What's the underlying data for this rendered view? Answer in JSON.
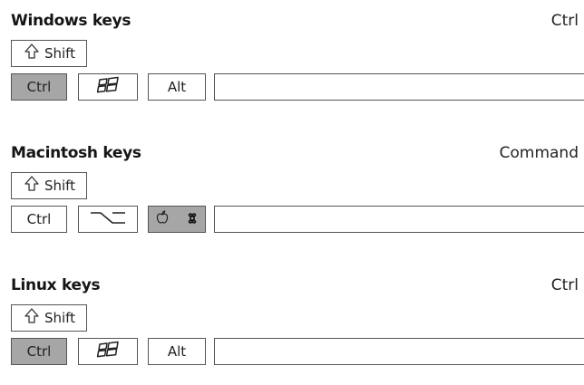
{
  "sections": [
    {
      "heading": "Windows keys",
      "modifier": "Ctrl",
      "shift_label": "Shift",
      "keys": [
        "Ctrl",
        "",
        "Alt"
      ]
    },
    {
      "heading": "Macintosh keys",
      "modifier": "Command",
      "shift_label": "Shift",
      "keys": [
        "Ctrl",
        "",
        ""
      ]
    },
    {
      "heading": "Linux keys",
      "modifier": "Ctrl",
      "shift_label": "Shift",
      "keys": [
        "Ctrl",
        "",
        "Alt"
      ]
    }
  ],
  "colors": {
    "highlighted_key": "#a6a6a6",
    "key_border": "#555555",
    "text": "#151515"
  },
  "icons": {
    "shift": "shift-arrow-icon",
    "windows": "windows-logo-icon",
    "option": "option-key-icon",
    "apple": "apple-logo-icon",
    "command": "command-symbol-icon"
  }
}
